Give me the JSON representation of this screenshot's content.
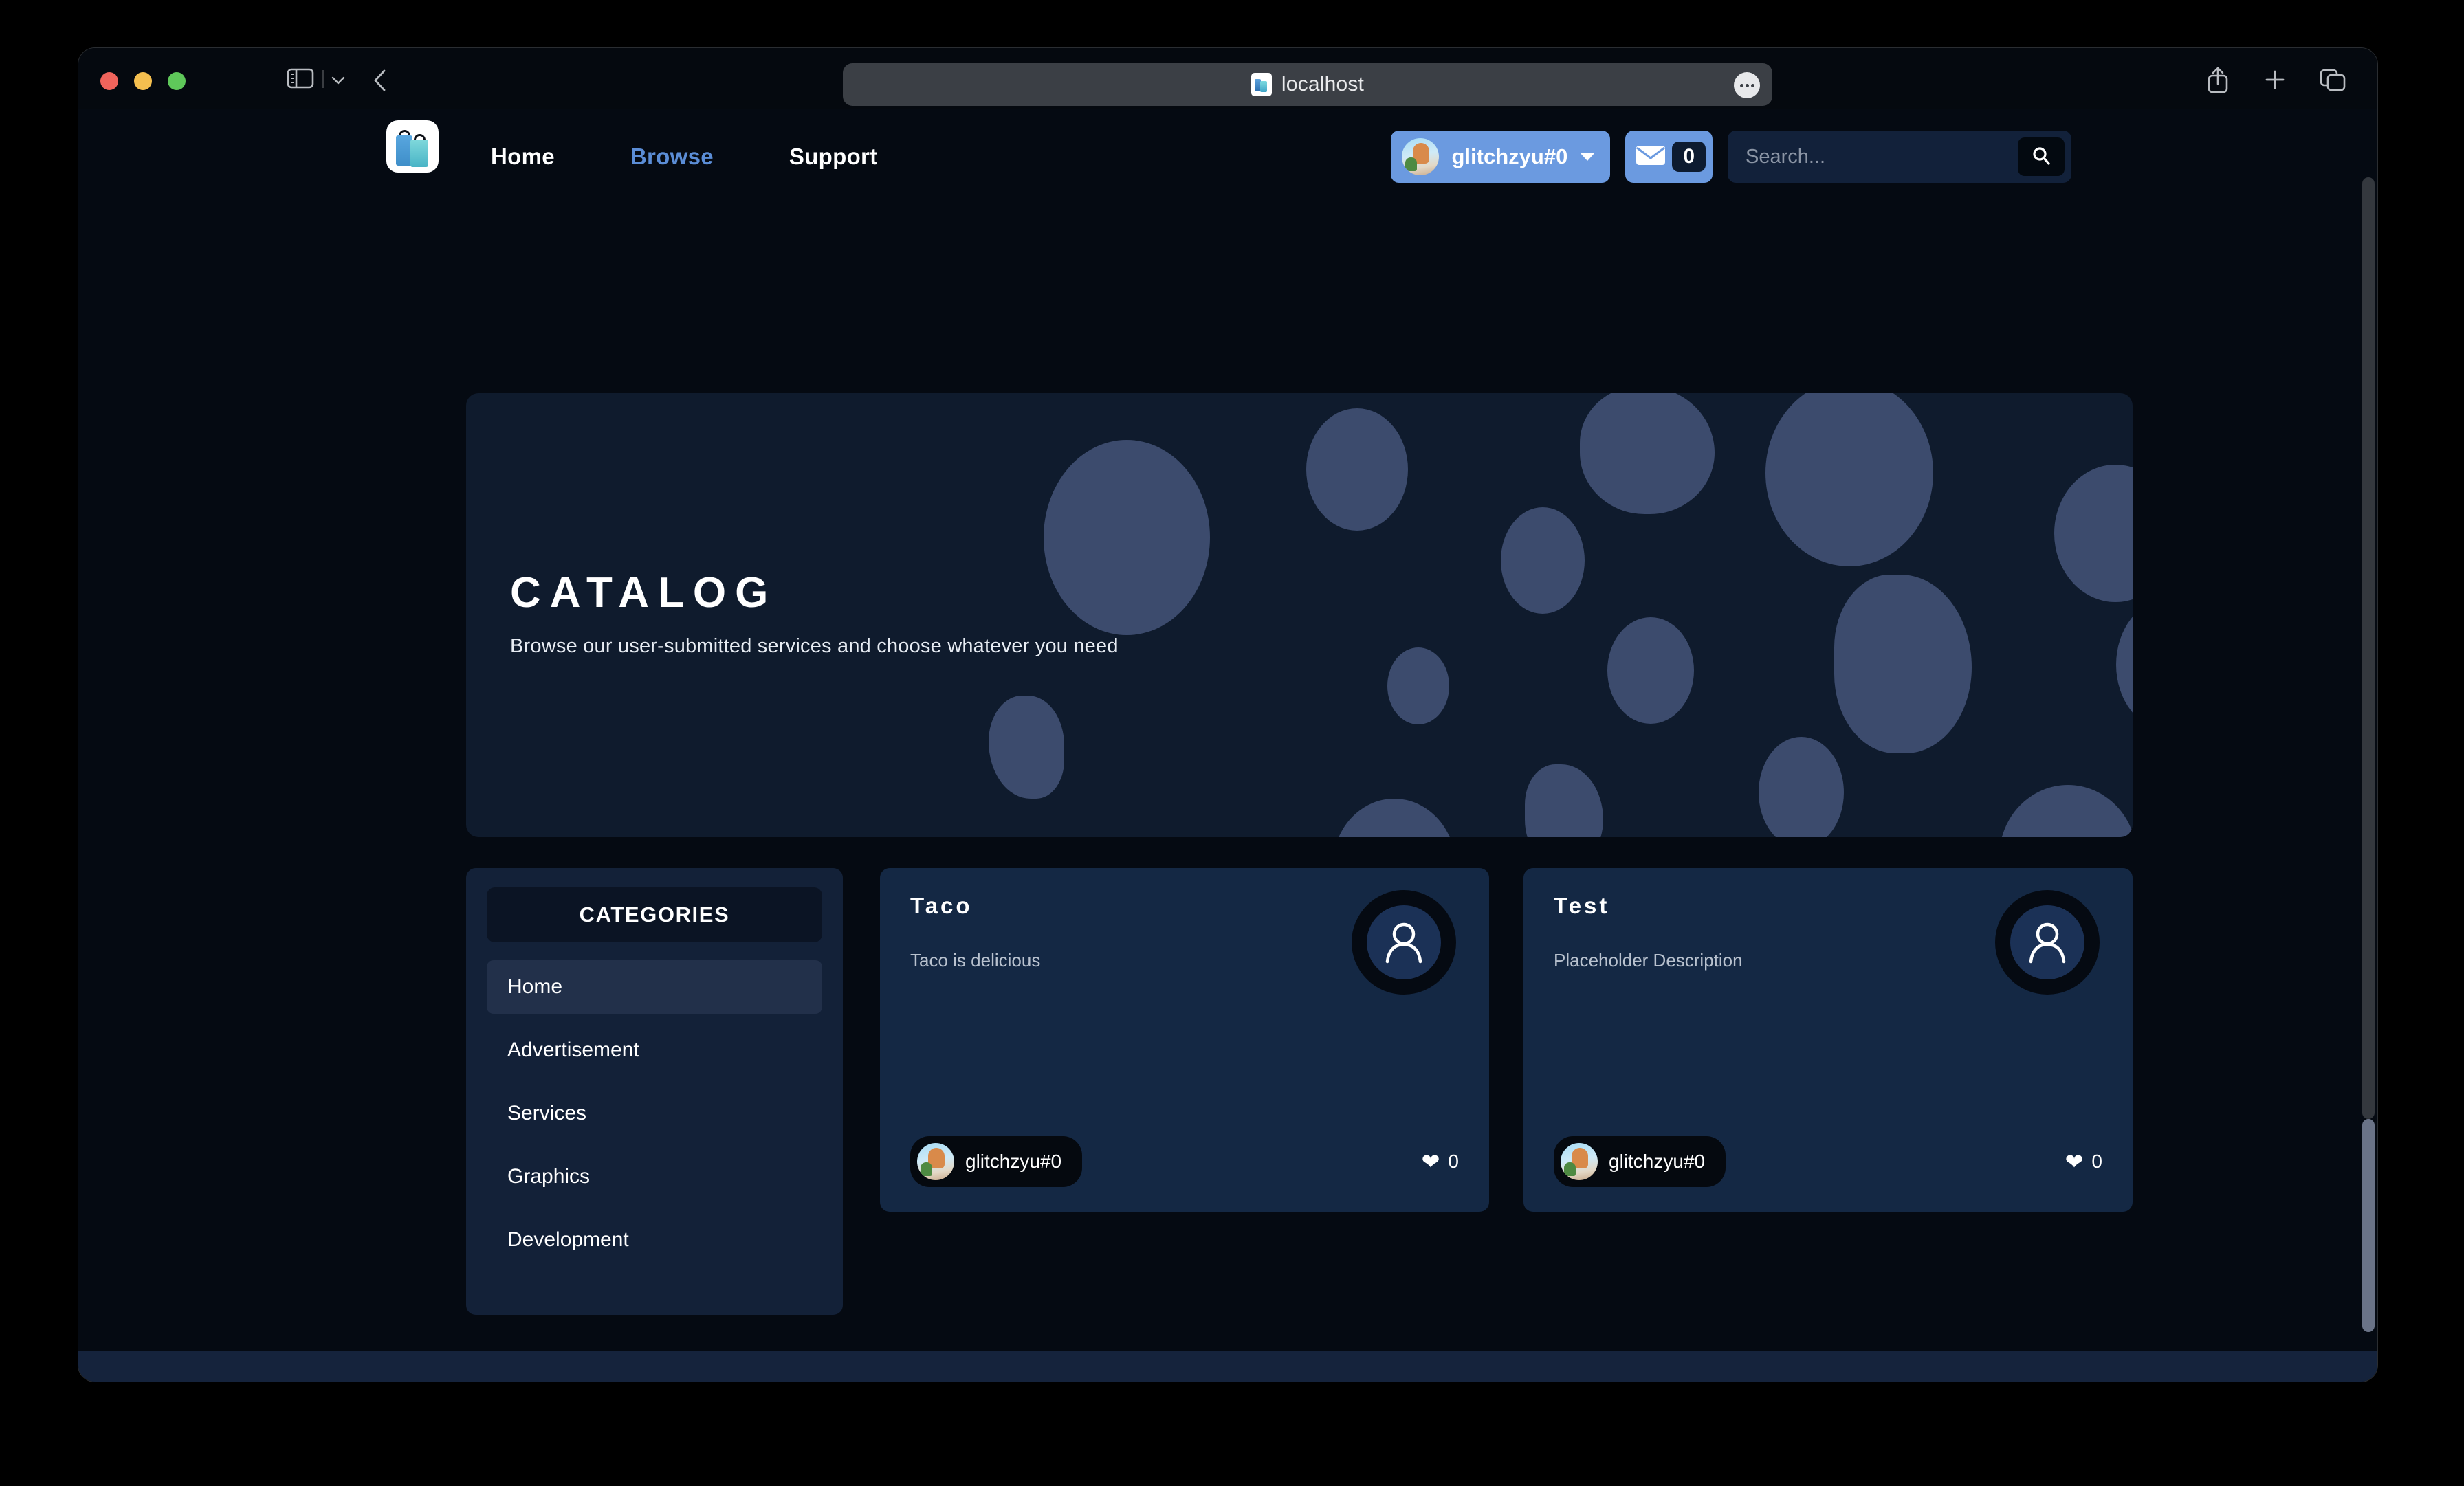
{
  "browser": {
    "address": {
      "url": "localhost",
      "favicon_icon": "shopping-bags-favicon",
      "menu_icon": "ellipsis-icon"
    },
    "controls": {
      "close_label": "",
      "minimize_label": "",
      "maximize_label": "",
      "sidebar_icon": "sidebar-toggle-icon",
      "sidebar_chevron_icon": "chevron-down-icon",
      "back_icon": "chevron-left-icon",
      "share_icon": "share-icon",
      "new_tab_icon": "plus-icon",
      "tab_overview_icon": "tab-overview-icon"
    }
  },
  "site": {
    "logo_icon": "shopping-bags-logo",
    "nav": [
      {
        "label": "Home",
        "active": false
      },
      {
        "label": "Browse",
        "active": true
      },
      {
        "label": "Support",
        "active": false
      }
    ],
    "user": {
      "name": "glitchzyu#0",
      "avatar_icon": "user-avatar-image",
      "caret_icon": "caret-down-icon"
    },
    "mail": {
      "icon": "envelope-icon",
      "count": "0"
    },
    "search": {
      "value": "",
      "placeholder": "Search...",
      "button_icon": "search-icon"
    }
  },
  "hero": {
    "title": "CATALOG",
    "subtitle": "Browse our user-submitted services and choose whatever you need"
  },
  "categories": {
    "header": "CATEGORIES",
    "items": [
      {
        "label": "Home",
        "active": true
      },
      {
        "label": "Advertisement",
        "active": false
      },
      {
        "label": "Services",
        "active": false
      },
      {
        "label": "Graphics",
        "active": false
      },
      {
        "label": "Development",
        "active": false
      }
    ]
  },
  "cards": [
    {
      "title": "Taco",
      "description": "Taco is delicious",
      "author": "glitchzyu#0",
      "likes": "0",
      "avatar_icon": "person-placeholder-icon",
      "like_icon": "heart-icon"
    },
    {
      "title": "Test",
      "description": "Placeholder Description",
      "author": "glitchzyu#0",
      "likes": "0",
      "avatar_icon": "person-placeholder-icon",
      "like_icon": "heart-icon"
    }
  ],
  "colors": {
    "page_bg": "#050a12",
    "panel": "#132138",
    "card": "#142844",
    "accent_blue": "#6b9ae0",
    "nav_active": "#5b8dd6",
    "hero_bg": "#0f1b2d",
    "hero_blob": "#3c4b6d",
    "footer": "#15233c"
  }
}
